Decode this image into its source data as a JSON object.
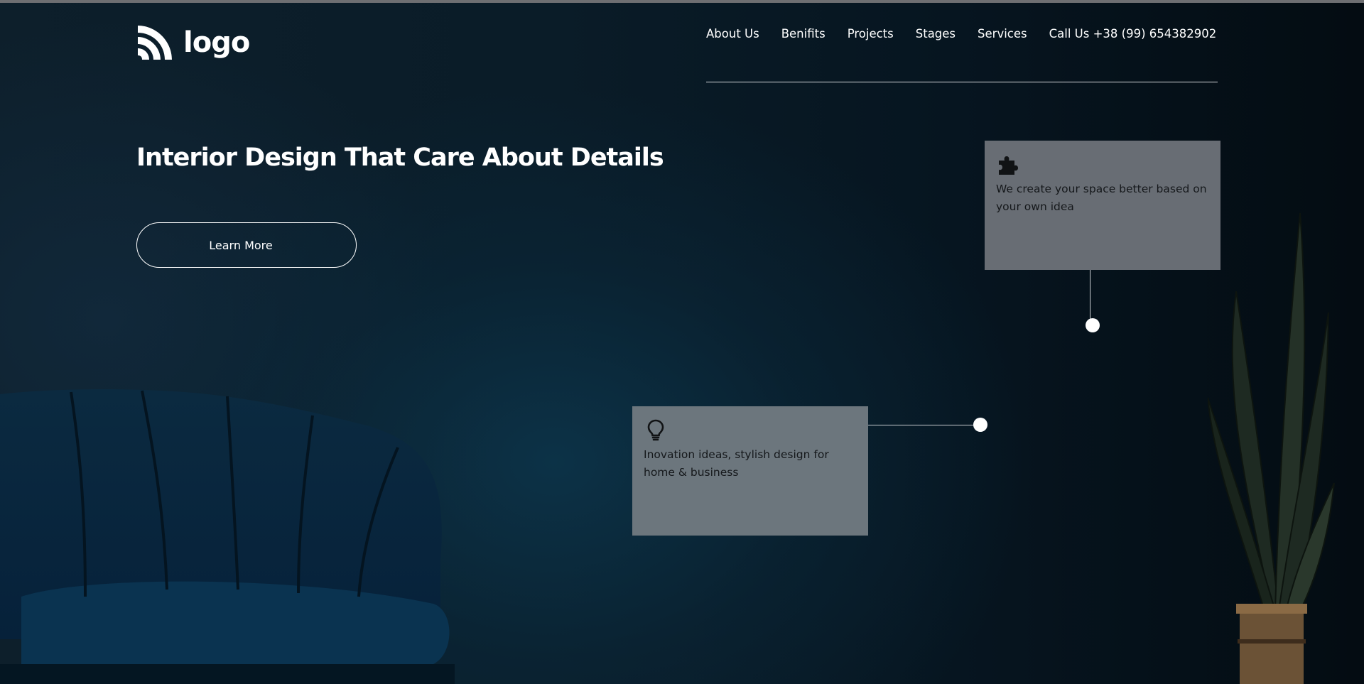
{
  "logo": {
    "text": "logo",
    "icon": "wave-stripes-logo-icon"
  },
  "nav": {
    "items": [
      {
        "label": "About Us"
      },
      {
        "label": "Benifits"
      },
      {
        "label": "Projects"
      },
      {
        "label": "Stages"
      },
      {
        "label": "Services"
      },
      {
        "label": "Call Us +38 (99) 654382902"
      }
    ]
  },
  "hero": {
    "title": "Interior Design That Care About Details",
    "button_label": "Learn More"
  },
  "cards": [
    {
      "icon": "puzzle-piece-icon",
      "text": "We create your space better based on your own idea"
    },
    {
      "icon": "lightbulb-icon",
      "text": "Inovation ideas, stylish design for home & business"
    }
  ],
  "colors": {
    "background": "#06141d",
    "card": "#6b737a",
    "text_light": "#ffffff",
    "text_dark": "#15181b"
  }
}
